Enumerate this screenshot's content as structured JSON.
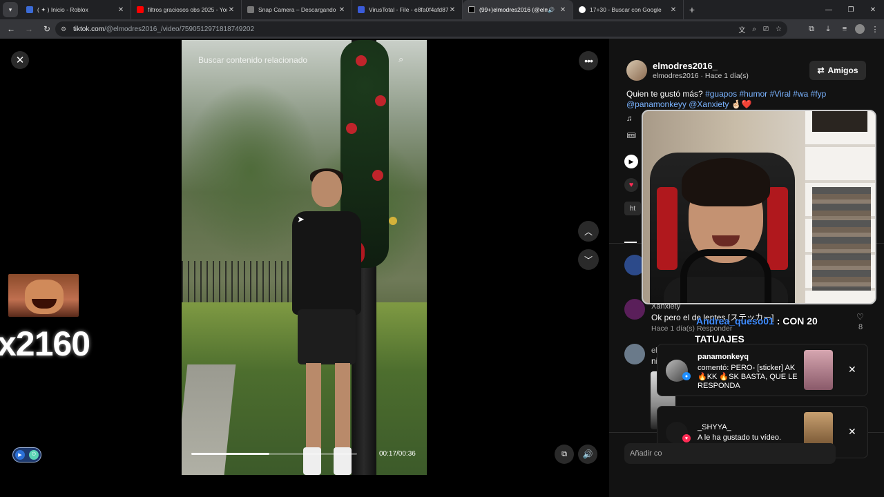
{
  "browser": {
    "tabs": [
      {
        "title": "( ✦ ) Inicio - Roblox",
        "color": "#3b6bd6",
        "active": false
      },
      {
        "title": "filtros graciosos obs 2025 - You",
        "color": "#ff0000",
        "active": false
      },
      {
        "title": "Snap Camera – Descargando",
        "color": "#555555",
        "active": false
      },
      {
        "title": "VirusTotal - File - e8fa0f4afd87…",
        "color": "#3a5bd9",
        "active": false
      },
      {
        "title": "(99+)elmodres2016 (@elm",
        "color": "#000000",
        "active": true
      },
      {
        "title": "17+30 - Buscar con Google",
        "color": "#4285f4",
        "active": false
      }
    ],
    "url_host": "tiktok.com",
    "url_path": "/@elmodres2016_/video/7590512971818749202"
  },
  "video": {
    "search_placeholder": "Buscar contenido relacionado",
    "time": "00:17/00:36",
    "progress": 0.47
  },
  "overlay": {
    "meme_count": "x2160"
  },
  "post": {
    "username": "elmodres2016_",
    "subline": "elmodres2016 · Hace 1 día(s)",
    "friends_label": "Amigos",
    "caption_text": "Quien te gustó más? ",
    "tags": "#guapos #humor #Viral #wa #fyp",
    "mentions": "@panamonkeyy @Xanxiety 🤞🏻❤️",
    "music_icon": "♫",
    "link_chip": "ht"
  },
  "comments": [
    {
      "user": "Xanxiety",
      "text": "Ok pero el de lentes [ステッカー]",
      "meta": "Hace 1 día(s)    Responder",
      "likes": "8"
    },
    {
      "user": "el",
      "text": "ni",
      "meta": "",
      "likes": ""
    }
  ],
  "chat": {
    "user": "Andrea_queso01",
    "msg": " : CON 20",
    "msg2": "TATUAJES"
  },
  "notifications": [
    {
      "user": "panamonkeyq",
      "text": "comentó: PERO- [sticker] AK 🔥KK 🔥SK BASTA, QUE LE RESPONDA",
      "badge_color": "#1f8fff"
    },
    {
      "user": "_SHYYA_",
      "text": "A le ha gustado tu vídeo.",
      "badge_color": "#fe2c55"
    }
  ],
  "add_comment_placeholder": "Añadir co"
}
